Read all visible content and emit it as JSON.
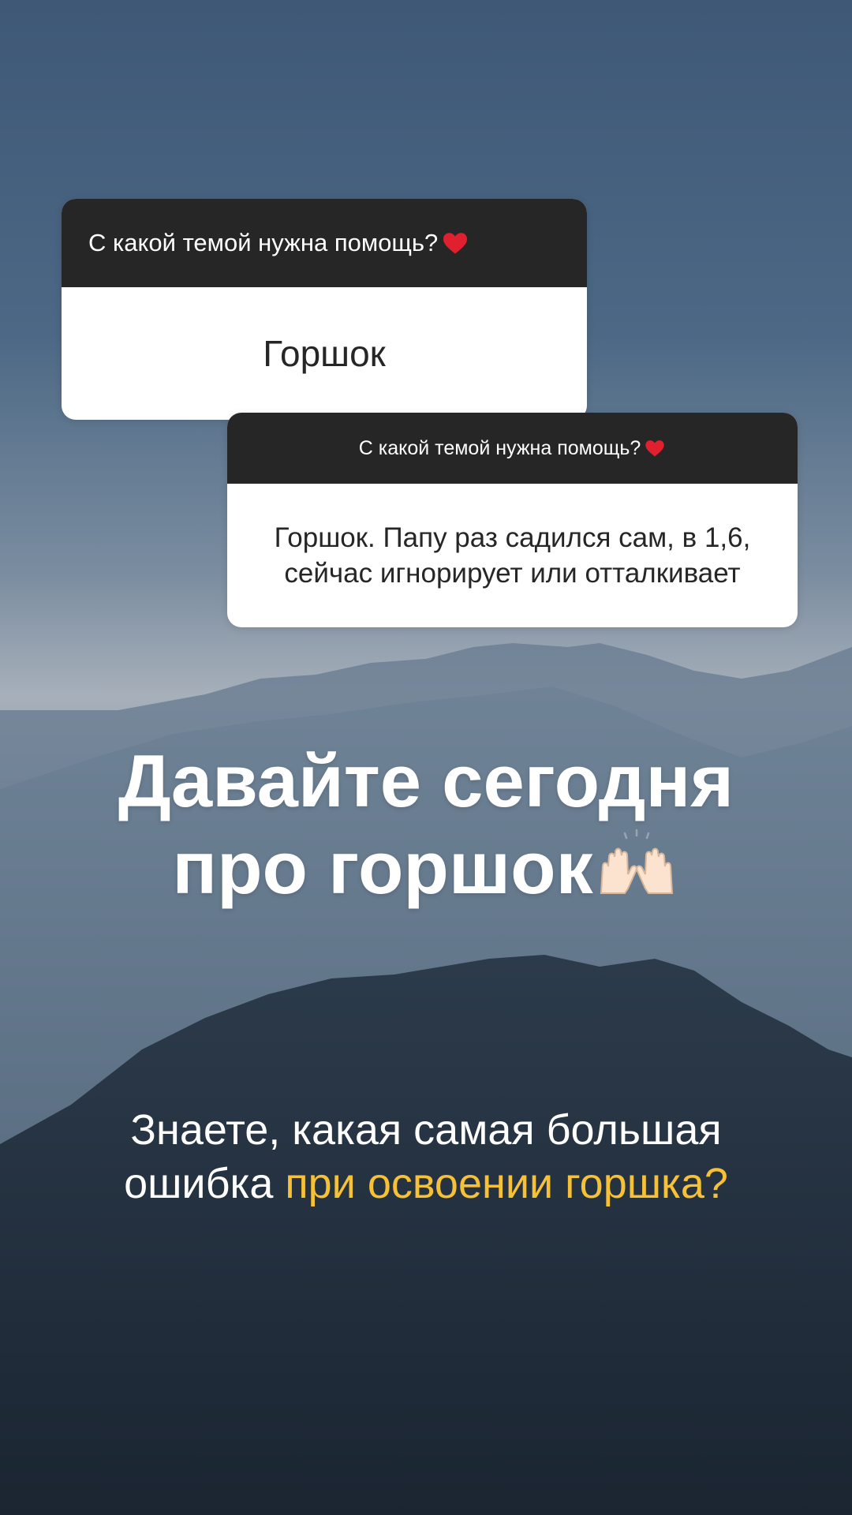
{
  "background": {
    "sky_top_color": "#3f5977",
    "haze_color": "#a9b1ba",
    "mountain_near_color": "#1e2a36"
  },
  "question_card_1": {
    "prompt": "С какой темой нужна помощь?",
    "prompt_emoji": "red-heart-icon",
    "answer": "Горшок"
  },
  "question_card_2": {
    "prompt": "С какой темой нужна помощь?",
    "prompt_emoji": "red-heart-icon",
    "answer_line1": "Горшок. Папу раз садился сам, в 1,6,",
    "answer_line2": "сейчас игнорирует или отталкивает"
  },
  "headline": {
    "line1": "Давайте сегодня",
    "line2": "про горшок",
    "emoji": "raising-hands-icon"
  },
  "subtext": {
    "line1": "Знаете, какая самая большая",
    "line2_plain": "ошибка",
    "line2_accent": "при освоении горшка?",
    "accent_color": "#f6c136"
  }
}
